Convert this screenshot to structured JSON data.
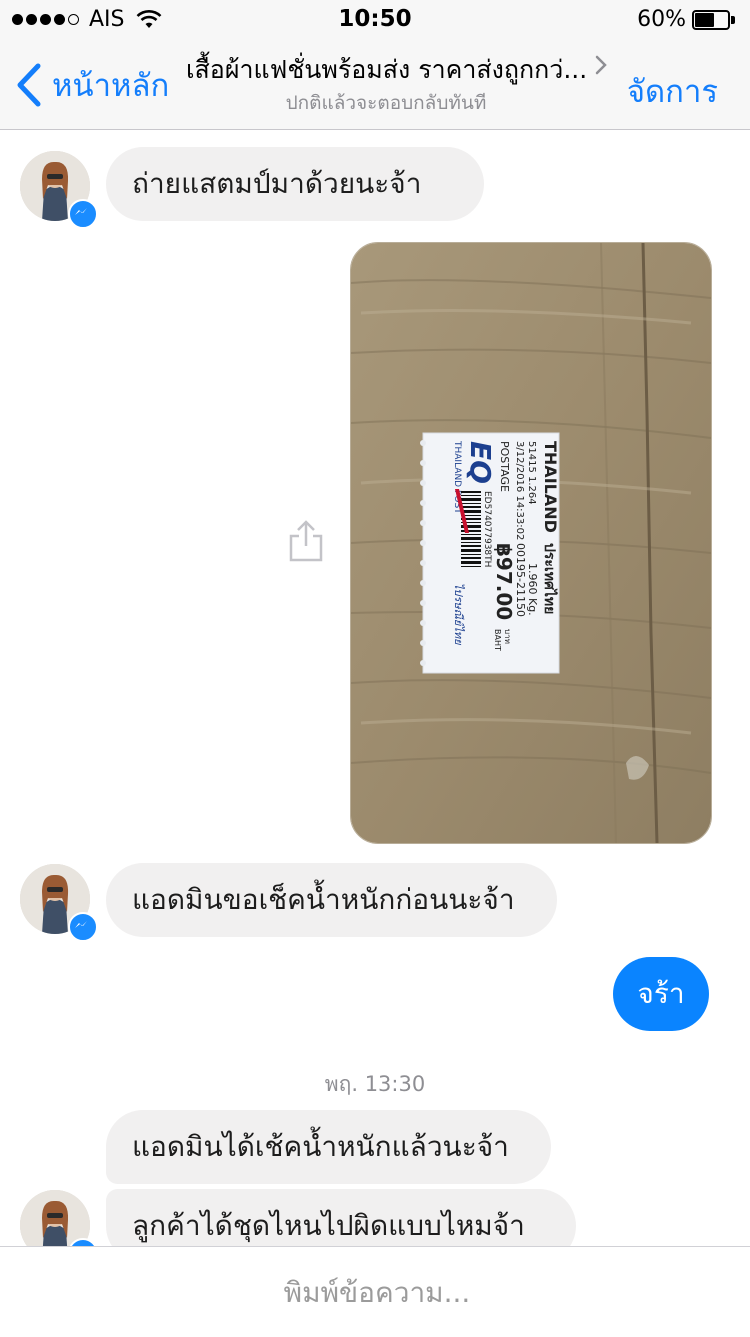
{
  "status_bar": {
    "carrier": "AIS",
    "time": "10:50",
    "battery_percent_text": "60%",
    "battery_level": 0.6
  },
  "nav": {
    "back_label": "หน้าหลัก",
    "title": "เสื้อผ้าแฟชั่นพร้อมส่ง ราคาส่งถูกกว่...",
    "subtitle": "ปกติแล้วจะตอบกลับทันที",
    "manage_label": "จัดการ"
  },
  "messages": {
    "m1": "ถ่ายแสตมป์มาด้วยนะจ้า",
    "m2": "แอดมินขอเช็คน้ำหนักก่อนนะจ้า",
    "m3": "จร้า",
    "timestamp": "พฤ. 13:30",
    "m4": "แอดมินได้เช้คน้ำหนักแล้วนะจ้า",
    "m5": "ลูกค้าได้ชุดไหนไปผิดแบบไหมจ้า"
  },
  "stamp": {
    "country": "THAILAND",
    "country_th": "ประเทศไทย",
    "line1": "51415 1.264",
    "datetime": "3/12/2016 14:33:02",
    "postage": "POSTAGE",
    "weight": "1.960 Kg.",
    "code": "00195-21150",
    "price": "฿97.00",
    "baht_th": "บาท",
    "baht": "BAHT",
    "service": "EQ",
    "tracking": "ED574077938TH",
    "post_brand": "THAILAND POST",
    "post_brand_th": "ไปรษณีย์ไทย"
  },
  "composer": {
    "placeholder": "พิมพ์ข้อความ..."
  },
  "colors": {
    "accent": "#147efb",
    "bubble_out": "#0a84ff",
    "bubble_in": "#f1f0f0",
    "messenger_badge": "#1a8cff"
  },
  "icons": [
    "back-chevron-icon",
    "wifi-icon",
    "battery-icon",
    "share-icon",
    "messenger-badge-icon"
  ]
}
